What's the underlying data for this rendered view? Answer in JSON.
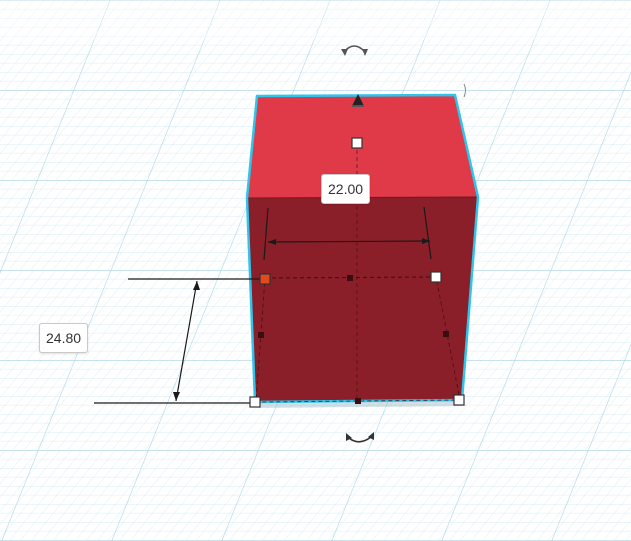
{
  "dimensions": {
    "width_value": "22.00",
    "height_value": "24.80"
  },
  "colors": {
    "background": "#ffffff",
    "grid_minor": "#c5e2ee",
    "grid_major": "#9ccde2",
    "box_top": "#e03a49",
    "box_front": "#8a1f29",
    "selection_outline": "#2fc4ea",
    "handle_fill": "#ffffff",
    "handle_active": "#e24a1c"
  },
  "icons": {
    "rotate_top": "rotate-arrow-icon",
    "rotate_bottom": "rotate-arrow-icon",
    "lift": "lift-cone-icon"
  }
}
